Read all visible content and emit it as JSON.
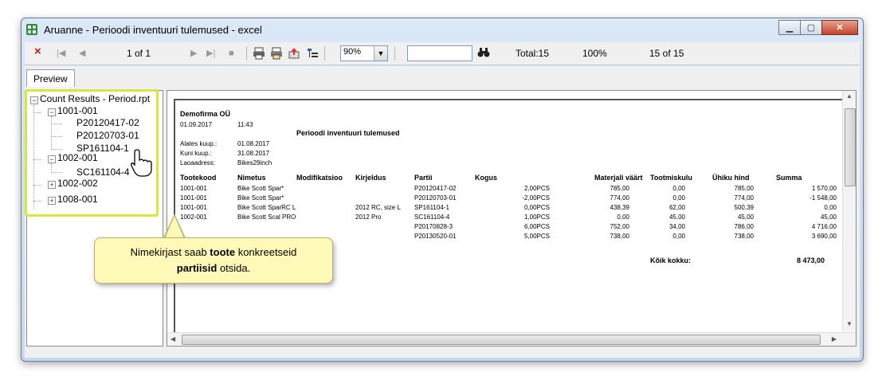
{
  "window": {
    "title": "Aruanne - Perioodi inventuuri tulemused - excel"
  },
  "toolbar": {
    "close_icon": "×",
    "first_icon": "|◀",
    "prev_icon": "◀",
    "page": "1 of 1",
    "next_icon": "▶",
    "last_icon": "▶|",
    "stop_icon": "■",
    "print_icon": "printer-icon",
    "zoom": "90%",
    "search_value": "",
    "total": "Total:15",
    "percent": "100%",
    "count": "15 of 15"
  },
  "tabs": {
    "preview": "Preview"
  },
  "tree": {
    "root": "Count Results - Period.rpt",
    "groups": [
      {
        "label": "1001-001",
        "expanded": true,
        "children": [
          "P20120417-02",
          "P20120703-01",
          "SP161104-1"
        ]
      },
      {
        "label": "1002-001",
        "expanded": true,
        "children": [
          "SC161104-4"
        ]
      },
      {
        "label": "1002-002",
        "expanded": false,
        "children": []
      },
      {
        "label": "1008-001",
        "expanded": false,
        "children": []
      }
    ]
  },
  "report": {
    "company": "Demofirma OÜ",
    "date": "01.09.2017",
    "time": "11:43",
    "title": "Perioodi inventuuri tulemused",
    "from_label": "Alates kuup.:",
    "from_value": "01.08.2017",
    "to_label": "Kuni kuup.:",
    "to_value": "31.08.2017",
    "warehouse_label": "Laoaadress:",
    "warehouse_value": "Bikes29inch",
    "headers": [
      "Tootekood",
      "Nimetus",
      "Modifikatsioo",
      "Kirjeldus",
      "Partii",
      "Kogus",
      "Materjali väärt",
      "Tootmiskulu",
      "Ühiku hind",
      "Summa"
    ],
    "rows": [
      [
        "1001-001",
        "Bike Scott Spar*",
        "",
        "",
        "P20120417-02",
        "2,00PCS",
        "785,00",
        "0,00",
        "785,00",
        "1 570,00"
      ],
      [
        "1001-001",
        "Bike Scott Spar*",
        "",
        "",
        "P20120703-01",
        "-2,00PCS",
        "774,00",
        "0,00",
        "774,00",
        "-1 548,00"
      ],
      [
        "1001-001",
        "Bike Scott SparRC L",
        "",
        "2012 RC, size L",
        "SP161104-1",
        "0,00PCS",
        "438,39",
        "62,00",
        "500,39",
        "0,00"
      ],
      [
        "1002-001",
        "Bike Scott Scal PRO",
        "",
        "2012 Pro",
        "SC161104-4",
        "1,00PCS",
        "0,00",
        "45,00",
        "45,00",
        "45,00"
      ],
      [
        "",
        "",
        "",
        "",
        "P20170828-3",
        "6,00PCS",
        "752,00",
        "34,00",
        "786,00",
        "4 716,00"
      ],
      [
        "",
        "",
        "",
        "",
        "P20130520-01",
        "5,00PCS",
        "738,00",
        "0,00",
        "738,00",
        "3 690,00"
      ]
    ],
    "grand_label": "Kõik kokku:",
    "grand_value": "8 473,00"
  },
  "callout": {
    "text_before": "Nimekirjast saab ",
    "bold1": "toote",
    "text_mid": " konkreetseid",
    "bold2": "partiisid",
    "text_after": " otsida."
  },
  "colors": {
    "highlight": "#d6e83a",
    "callout_bg": "#fff9b8",
    "close_red": "#c0181a"
  }
}
